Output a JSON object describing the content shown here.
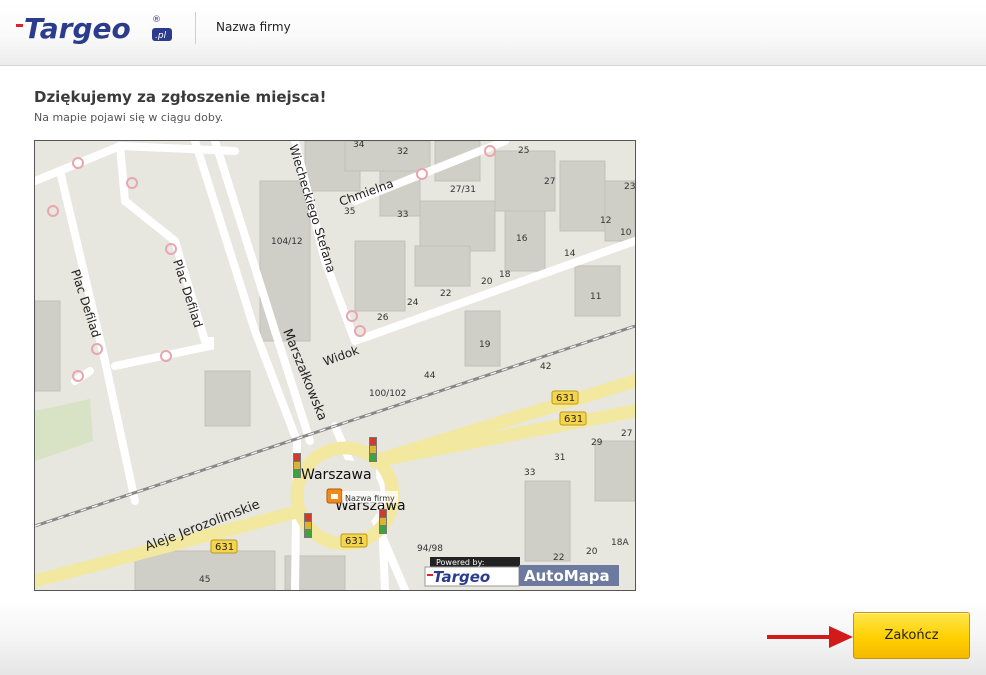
{
  "header": {
    "logo_text": "Targeo",
    "logo_suffix": ".pl",
    "company_name": "Nazwa firmy"
  },
  "content": {
    "title": "Dziękujemy za zgłoszenie miejsca!",
    "subtitle": "Na mapie pojawi się w ciągu doby."
  },
  "map": {
    "streets": {
      "plac_defilad_1": "Plac Defilad",
      "plac_defilad_2": "Plac Defilad",
      "marszalkowska": "Marszałkowska",
      "wiecheckiego": "Wiecheckiego Stefana",
      "chmielna": "Chmielna",
      "widok": "Widok",
      "aleje": "Aleje Jerozolimskie"
    },
    "places": {
      "warszawa_1": "Warszawa",
      "warszawa_2": "Warszawa",
      "marker": "Nazwa firmy"
    },
    "road_badge": "631",
    "house_numbers": {
      "n34": "34",
      "n32": "32",
      "n25": "25",
      "n27_31": "27/31",
      "n27a": "27",
      "n23": "23",
      "n35": "35",
      "n33a": "33",
      "n12": "12",
      "n10": "10",
      "n104": "104/12",
      "n16": "16",
      "n14": "14",
      "n22": "22",
      "n20": "20",
      "n18": "18",
      "n11": "11",
      "n24": "24",
      "n26": "26",
      "n19": "19",
      "n44": "44",
      "n42": "42",
      "n100": "100/102",
      "n27b": "27",
      "n29": "29",
      "n33b": "33",
      "n31": "31",
      "n94": "94/98",
      "n22b": "22",
      "n20b": "20",
      "n18a": "18A",
      "n45": "45"
    },
    "branding": {
      "powered_by": "Powered by:",
      "targeo": "Targeo",
      "automapa": "AutoMapa"
    }
  },
  "footer": {
    "finish_label": "Zakończ"
  }
}
